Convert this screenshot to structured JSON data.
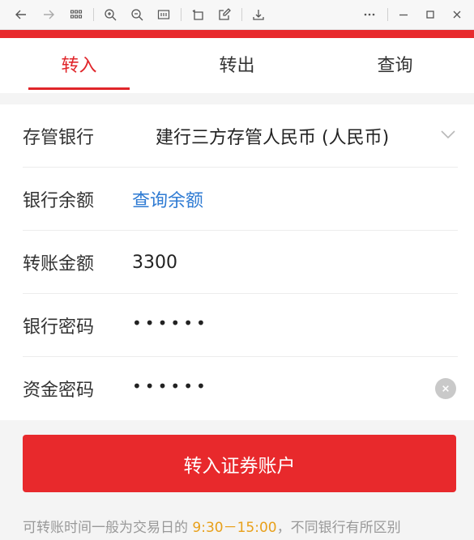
{
  "tabs": [
    {
      "label": "转入",
      "active": true
    },
    {
      "label": "转出",
      "active": false
    },
    {
      "label": "查询",
      "active": false
    }
  ],
  "form": {
    "bank": {
      "label": "存管银行",
      "value": "建行三方存管人民币 (人民币)"
    },
    "balance": {
      "label": "银行余额",
      "link": "查询余额"
    },
    "amount": {
      "label": "转账金额",
      "value": "3300"
    },
    "bank_password": {
      "label": "银行密码",
      "value": "••••••"
    },
    "fund_password": {
      "label": "资金密码",
      "value": "••••••"
    }
  },
  "submit_label": "转入证券账户",
  "note": {
    "prefix": "可转账时间一般为交易日的 ",
    "time": "9:30－15:00",
    "suffix": "，不同银行有所区别"
  },
  "colors": {
    "brand_red": "#e8292c",
    "link_blue": "#2f7bd3",
    "highlight_orange": "#e8a01a"
  },
  "icons": [
    "back-arrow-icon",
    "forward-arrow-icon",
    "grid-icon",
    "zoom-in-icon",
    "zoom-out-icon",
    "reader-icon",
    "rotate-icon",
    "edit-icon",
    "download-icon",
    "more-icon",
    "minimize-icon",
    "maximize-icon",
    "close-icon",
    "chevron-down-icon",
    "clear-icon"
  ]
}
